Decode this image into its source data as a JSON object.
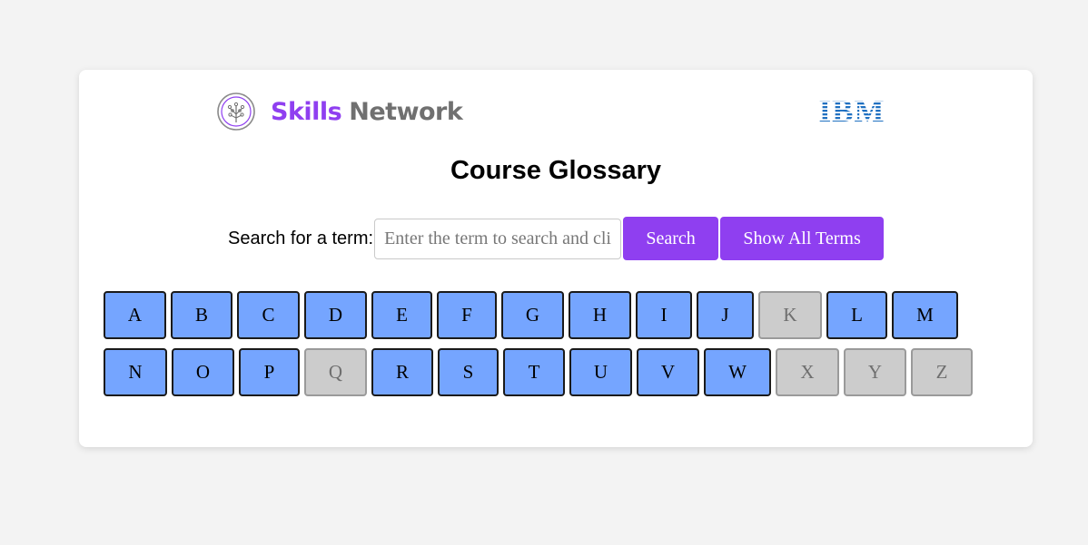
{
  "header": {
    "brand_left_word1": "Skills",
    "brand_left_word2": "Network",
    "brand_right": "IBM"
  },
  "title": "Course Glossary",
  "search": {
    "label": "Search for a term:",
    "placeholder": "Enter the term to search and click Search",
    "value": "",
    "search_button": "Search",
    "show_all_button": "Show All Terms"
  },
  "letters_row1": [
    {
      "label": "A",
      "enabled": true
    },
    {
      "label": "B",
      "enabled": true
    },
    {
      "label": "C",
      "enabled": true
    },
    {
      "label": "D",
      "enabled": true
    },
    {
      "label": "E",
      "enabled": true
    },
    {
      "label": "F",
      "enabled": true
    },
    {
      "label": "G",
      "enabled": true
    },
    {
      "label": "H",
      "enabled": true
    },
    {
      "label": "I",
      "enabled": true
    },
    {
      "label": "J",
      "enabled": true
    },
    {
      "label": "K",
      "enabled": false
    },
    {
      "label": "L",
      "enabled": true
    },
    {
      "label": "M",
      "enabled": true
    }
  ],
  "letters_row2": [
    {
      "label": "N",
      "enabled": true
    },
    {
      "label": "O",
      "enabled": true
    },
    {
      "label": "P",
      "enabled": true
    },
    {
      "label": "Q",
      "enabled": false
    },
    {
      "label": "R",
      "enabled": true
    },
    {
      "label": "S",
      "enabled": true
    },
    {
      "label": "T",
      "enabled": true
    },
    {
      "label": "U",
      "enabled": true
    },
    {
      "label": "V",
      "enabled": true
    },
    {
      "label": "W",
      "enabled": true
    },
    {
      "label": "X",
      "enabled": false
    },
    {
      "label": "Y",
      "enabled": false
    },
    {
      "label": "Z",
      "enabled": false
    }
  ],
  "colors": {
    "accent": "#8f3ff0",
    "letter_enabled": "#75a5ff",
    "letter_disabled": "#cccccc",
    "ibm_blue": "#1f70c1"
  }
}
